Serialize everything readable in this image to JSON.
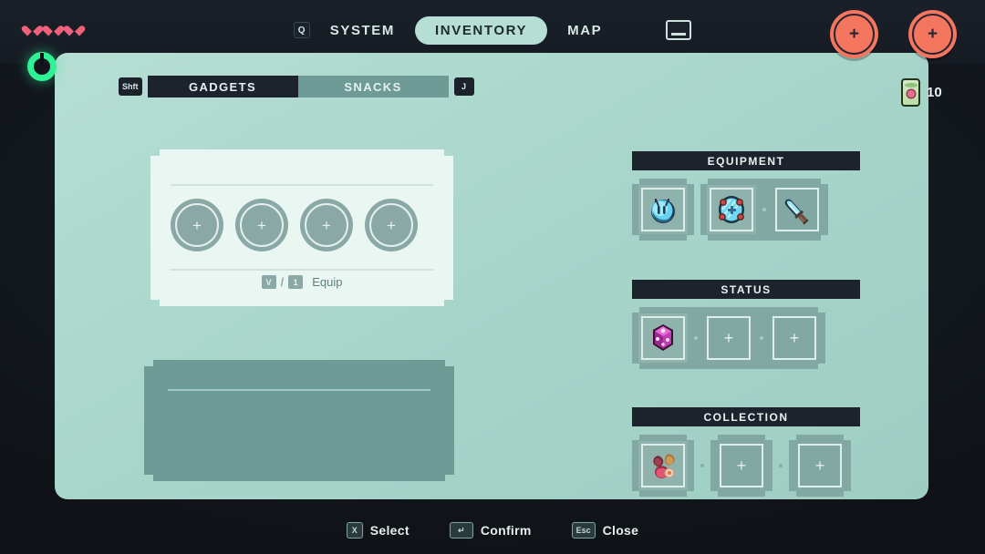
{
  "hud": {
    "hearts": 3,
    "heart_color": "#f0617c",
    "stamina_icon": "stamina-ring-icon",
    "stamina_color": "#2ff296"
  },
  "nav": {
    "left_key": "Q",
    "right_key": "spacebar-icon",
    "tabs": [
      {
        "label": "SYSTEM",
        "active": false
      },
      {
        "label": "INVENTORY",
        "active": true
      },
      {
        "label": "MAP",
        "active": false
      }
    ],
    "shoulder_buttons": [
      {
        "label": "+",
        "name": "left-shoulder-button"
      },
      {
        "label": "+",
        "name": "right-shoulder-button"
      }
    ],
    "accent_color": "#f4765f"
  },
  "currency": {
    "icon": "money-card-icon",
    "count": "10"
  },
  "categories": {
    "left_key": "Shft",
    "right_key": "J",
    "tabs": [
      {
        "label": "GADGETS",
        "active": true
      },
      {
        "label": "SNACKS",
        "active": false
      }
    ]
  },
  "grid": {
    "slots": [
      {
        "label": "+",
        "filled": false
      },
      {
        "label": "+",
        "filled": false
      },
      {
        "label": "+",
        "filled": false
      },
      {
        "label": "+",
        "filled": false
      }
    ],
    "hint": {
      "key_a": "V",
      "separator": "/",
      "key_b": "1",
      "label": "Equip"
    }
  },
  "description": {
    "title": "",
    "body": ""
  },
  "sections": [
    {
      "name": "equipment",
      "title": "EQUIPMENT",
      "groups": [
        {
          "slots": [
            {
              "icon": "blue-creature-helmet-icon",
              "filled": true,
              "label": ""
            }
          ]
        },
        {
          "slots": [
            {
              "icon": "cyan-shield-orb-icon",
              "filled": true,
              "label": ""
            },
            {
              "icon": "cyan-blade-sword-icon",
              "filled": false,
              "label": ""
            }
          ]
        }
      ]
    },
    {
      "name": "status",
      "title": "STATUS",
      "groups": [
        {
          "slots": [
            {
              "icon": "magenta-crystal-icon",
              "filled": true,
              "label": ""
            },
            {
              "icon": "empty-slot-icon",
              "filled": false,
              "label": "+"
            },
            {
              "icon": "empty-slot-icon",
              "filled": false,
              "label": "+"
            }
          ]
        }
      ]
    },
    {
      "name": "collection",
      "title": "COLLECTION",
      "groups": [
        {
          "slots": [
            {
              "icon": "red-meat-cluster-icon",
              "filled": true,
              "label": ""
            }
          ]
        },
        {
          "slots": [
            {
              "icon": "empty-slot-icon",
              "filled": false,
              "label": "+"
            }
          ]
        },
        {
          "slots": [
            {
              "icon": "empty-slot-icon",
              "filled": false,
              "label": "+"
            }
          ]
        }
      ]
    }
  ],
  "bottom_hints": [
    {
      "key": "X",
      "label": "Select",
      "key_name": "key-x"
    },
    {
      "key": "↵",
      "label": "Confirm",
      "key_name": "key-enter"
    },
    {
      "key": "Esc",
      "label": "Close",
      "key_name": "key-esc"
    }
  ],
  "theme": {
    "panel_bg": "#a9d6cb",
    "panel_dark": "#1d232c",
    "slot_bg": "#81a8a3",
    "card_light": "#e9f6f2",
    "desc_bg": "#6d9b96",
    "window_bg": "#14181f"
  }
}
